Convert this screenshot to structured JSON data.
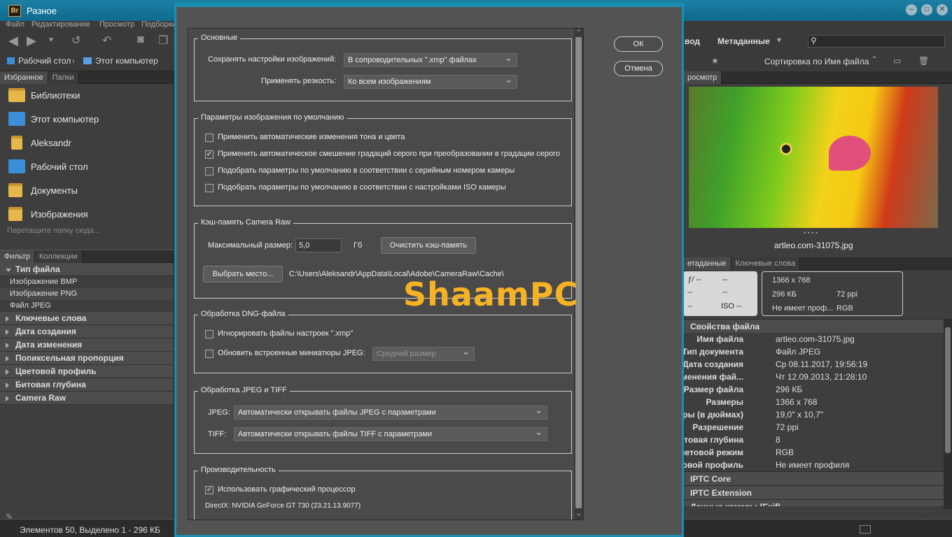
{
  "window": {
    "title": "Разное",
    "app_icon": "Br"
  },
  "menu": [
    "Файл",
    "Редактирование",
    "Просмотр",
    "Подборки"
  ],
  "path": {
    "desktop": "Рабочий стол",
    "computer": "Этот компьютер"
  },
  "left": {
    "tabs": [
      "Избранное",
      "Папки"
    ],
    "favorites": [
      "Библиотеки",
      "Этот компьютер",
      "Aleksandr",
      "Рабочий стол",
      "Документы",
      "Изображения"
    ],
    "drop_hint": "Перетащите папку сюда...",
    "filter_tabs": [
      "Фильтр",
      "Коллекции"
    ],
    "filter_open": "Тип файла",
    "filter_items": [
      "Изображение BMP",
      "Изображение PNG",
      "Файл JPEG"
    ],
    "filter_groups": [
      "Ключевые слова",
      "Дата создания",
      "Дата изменения",
      "Попиксельная пропорция",
      "Цветовой профиль",
      "Битовая глубина",
      "Camera Raw"
    ]
  },
  "status": "Элементов 50, Выделено 1 - 296 КБ",
  "right": {
    "top_labels": {
      "workspace": "вод",
      "metadata": "Метаданные",
      "sort": "Сортировка по Имя файла"
    },
    "preview_tab": "росмотр",
    "filename": "artleo.com-31075.jpg",
    "meta_tabs": [
      "етаданные",
      "Ключевые слова"
    ],
    "camera": {
      "f": "ƒ/ --",
      "c1": "--",
      "c2": "--",
      "c3": "--",
      "c4": "--",
      "iso": "ISO --"
    },
    "summary": {
      "size": "1366 x 768",
      "filesize": "296 КБ",
      "ppi": "72 ppi",
      "profile": "Не имеет проф...",
      "mode": "RGB"
    },
    "section": "Свойства файла",
    "props": [
      {
        "k": "Имя файла",
        "v": "artleo.com-31075.jpg"
      },
      {
        "k": "Тип документа",
        "v": "Файл JPEG"
      },
      {
        "k": "Дата создания",
        "v": "Ср 08.11.2017, 19:56:19"
      },
      {
        "k": "ата изменения фай...",
        "v": "Чт 12.09.2013, 21:28:10"
      },
      {
        "k": "Размер файла",
        "v": "296 КБ"
      },
      {
        "k": "Размеры",
        "v": "1366 x 768"
      },
      {
        "k": "азмеры (в дюймах)",
        "v": "19,0\" x 10,7\""
      },
      {
        "k": "Разрешение",
        "v": "72 ppi"
      },
      {
        "k": "Битовая глубина",
        "v": "8"
      },
      {
        "k": "Цветовой режим",
        "v": "RGB"
      },
      {
        "k": "Цветовой профиль",
        "v": "Не имеет профиля"
      }
    ],
    "sections_more": [
      "IPTC Core",
      "IPTC Extension",
      "Данные камеры (Exif)"
    ]
  },
  "dialog": {
    "ok": "ОК",
    "cancel": "Отмена",
    "g1": {
      "title": "Основные",
      "save_label": "Сохранять настройки изображений:",
      "save_value": "В сопроводительных \".xmp\" файлах",
      "sharp_label": "Применять резкость:",
      "sharp_value": "Ко всем изображениям"
    },
    "g2": {
      "title": "Параметры изображения по умолчанию",
      "c1": "Применить автоматические изменения тона и цвета",
      "c2": "Применить автоматическое смешение градаций серого при преобразовании в градации серого",
      "c3": "Подобрать параметры по умолчанию в соответствии с серийным номером камеры",
      "c4": "Подобрать параметры по умолчанию в соответствии с настройками ISO камеры"
    },
    "g3": {
      "title": "Кэш-память Camera Raw",
      "max_label": "Максимальный размер:",
      "max_value": "5,0",
      "unit": "Гб",
      "clear": "Очистить кэш-память",
      "choose": "Выбрать место...",
      "path": "C:\\Users\\Aleksandr\\AppData\\Local\\Adobe\\CameraRaw\\Cache\\"
    },
    "g4": {
      "title": "Обработка DNG-файла",
      "c1": "Игнорировать файлы настроек \".xmp\"",
      "c2": "Обновить встроенные миниатюры JPEG:",
      "preview_size": "Средний размер"
    },
    "g5": {
      "title": "Обработка JPEG и TIFF",
      "jpeg_label": "JPEG:",
      "jpeg_value": "Автоматически открывать файлы JPEG с параметрами",
      "tiff_label": "TIFF:",
      "tiff_value": "Автоматически открывать файлы TIFF с параметрами"
    },
    "g6": {
      "title": "Производительность",
      "gpu": "Использовать графический процессор",
      "directx": "DirectX: NVIDIA GeForce GT 730 (23.21.13.9077)"
    }
  },
  "watermark": "ShaamPC",
  "colors": {
    "accent": "#1a8fb4",
    "watermark": "#f5b324"
  }
}
